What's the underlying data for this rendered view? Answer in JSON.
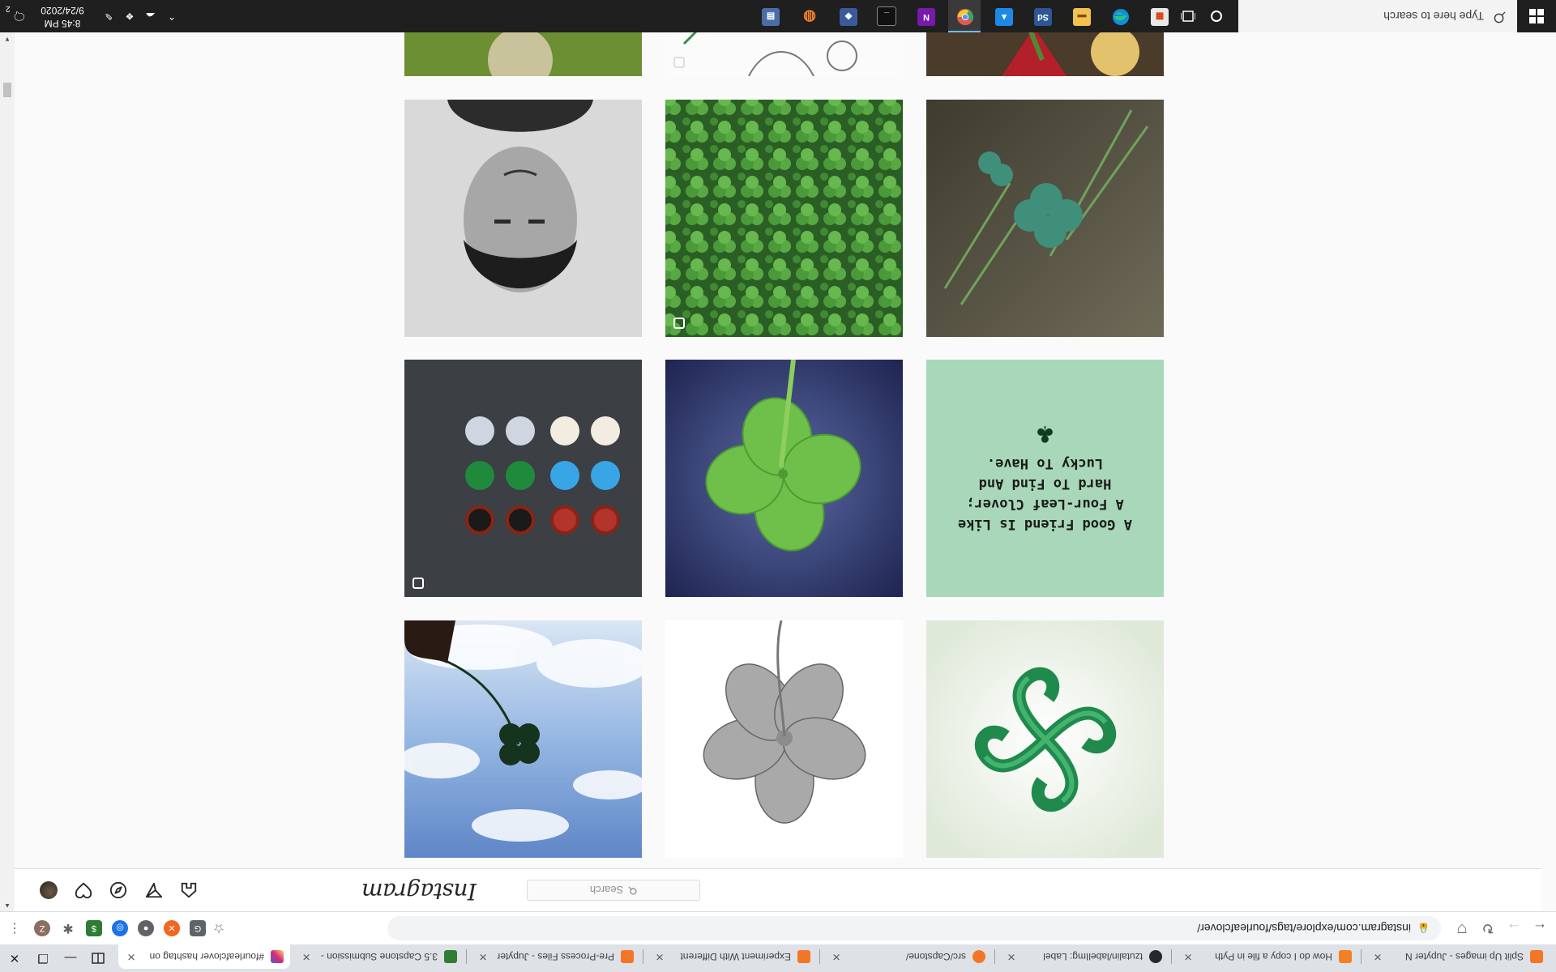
{
  "browser": {
    "tabs": [
      {
        "title": "Split Up images - Jupyter N",
        "favicon_color": "#f37626",
        "active": false
      },
      {
        "title": "How do I copy a file in Pyth",
        "favicon_color": "#f48024",
        "active": false
      },
      {
        "title": "tzutalin/labelImg: Label",
        "favicon_color": "#24292e",
        "active": false
      },
      {
        "title": "src/Capstone/",
        "favicon_color": "#f37626",
        "active": false
      },
      {
        "title": "Experiment With Different",
        "favicon_color": "#f37626",
        "active": false
      },
      {
        "title": "Pre-Process Files - Jupyter",
        "favicon_color": "#f37626",
        "active": false
      },
      {
        "title": "3.5 Capstone Submission -",
        "favicon_color": "#2f7d32",
        "active": false
      },
      {
        "title": "#fourleafclover hashtag on",
        "favicon_color": "#c13584",
        "active": true
      }
    ],
    "url": "instagram.com/explore/tags/fourleafclover/"
  },
  "instagram": {
    "logo": "Instagram",
    "search_placeholder": "Search",
    "nav_icons": [
      "home-icon",
      "direct-icon",
      "explore-icon",
      "activity-icon",
      "profile-avatar"
    ]
  },
  "grid": {
    "rows": [
      [
        {
          "name": "clover-logo-emblem-post",
          "badge": false
        },
        {
          "name": "drawn-flower-petals-post",
          "badge": false
        },
        {
          "name": "clover-against-sky-post",
          "badge": false
        }
      ],
      [
        {
          "name": "quote-card-post",
          "badge": false,
          "text": [
            "A Good Friend Is Like",
            "A Four-Leaf Clover;",
            "Hard To Find And",
            "Lucky To Have."
          ]
        },
        {
          "name": "four-leaf-clover-closeup-post",
          "badge": false
        },
        {
          "name": "clover-earrings-post",
          "badge": true
        }
      ],
      [
        {
          "name": "clover-on-ground-post",
          "badge": false
        },
        {
          "name": "clover-field-post",
          "badge": true
        },
        {
          "name": "bw-portrait-post",
          "badge": false
        }
      ],
      [
        {
          "name": "plant-pot-post",
          "badge": false
        },
        {
          "name": "sketch-post",
          "badge": true
        },
        {
          "name": "garden-photo-post",
          "badge": false
        }
      ]
    ]
  },
  "taskbar": {
    "search_placeholder": "Type here to search",
    "apps": [
      "task-view",
      "file-explorer",
      "edge",
      "chrome",
      "onenote",
      "terminal",
      "photos",
      "anaconda",
      "store",
      "photoshop",
      "excel"
    ],
    "clock_time": "8:45 PM",
    "clock_date": "9/24/2020",
    "notification_count": "2"
  },
  "colors": {
    "accent_blue": "#0095f6",
    "clover_green": "#2e8b3d",
    "taskbar_bg": "#1f1f1f"
  }
}
